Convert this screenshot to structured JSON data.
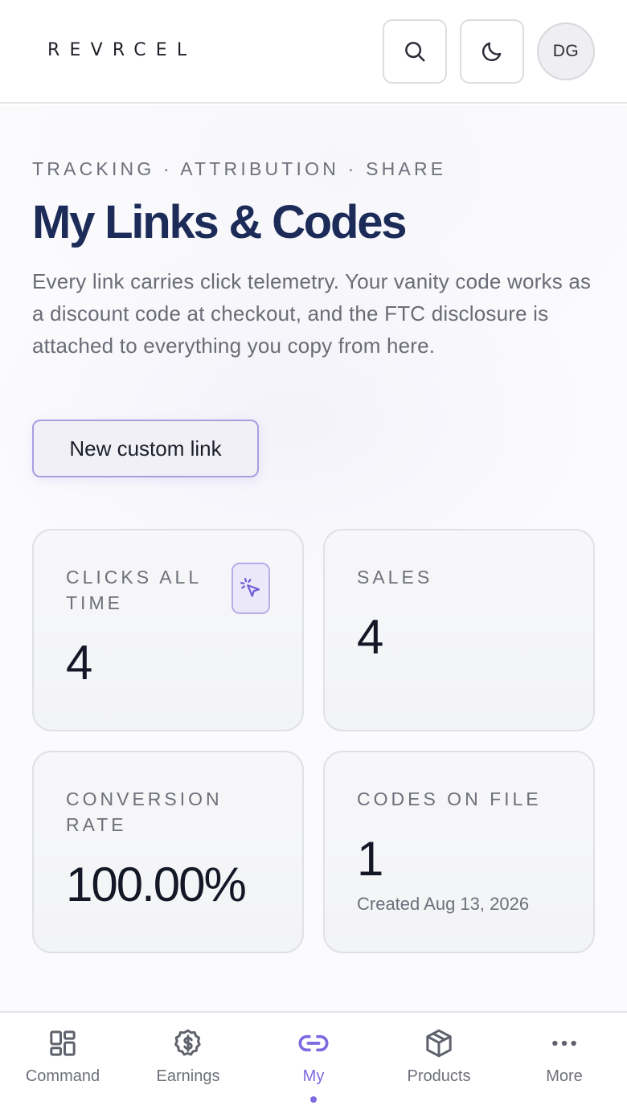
{
  "header": {
    "logo": "REVRCEL",
    "avatar_initials": "DG",
    "search_icon": "search-icon",
    "theme_icon": "moon-icon"
  },
  "hero": {
    "eyebrow": "TRACKING · ATTRIBUTION · SHARE",
    "title": "My Links & Codes",
    "description": "Every link carries click telemetry. Your vanity code works as a discount code at checkout, and the FTC disclosure is attached to everything you copy from here.",
    "new_link_label": "New custom link"
  },
  "stats": {
    "clicks": {
      "label": "CLICKS ALL TIME",
      "value": "4",
      "icon": "cursor-click-icon"
    },
    "sales": {
      "label": "SALES",
      "value": "4"
    },
    "conversion": {
      "label": "CONVERSION RATE",
      "value": "100.00%"
    },
    "codes": {
      "label": "CODES ON FILE",
      "value": "1",
      "sub": "Created Aug 13, 2026"
    }
  },
  "nav": {
    "items": [
      {
        "label": "Command",
        "icon": "grid-icon"
      },
      {
        "label": "Earnings",
        "icon": "dollar-circle-icon"
      },
      {
        "label": "My",
        "icon": "link-icon",
        "active": true
      },
      {
        "label": "Products",
        "icon": "box-icon"
      },
      {
        "label": "More",
        "icon": "more-icon"
      }
    ]
  },
  "colors": {
    "accent": "#7b6be0",
    "title": "#1c2b58"
  }
}
